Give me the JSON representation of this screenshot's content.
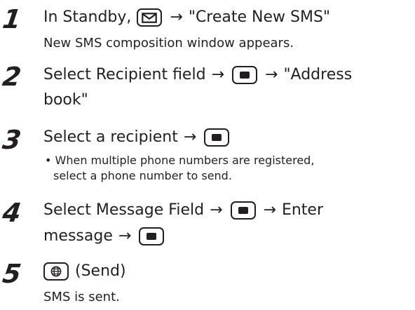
{
  "steps": [
    {
      "number": "1",
      "line1_before": "In Standby,",
      "arrow": "→",
      "line1_after": "\"Create New SMS\"",
      "note": "New SMS composition window appears.",
      "icon": "mail-key-icon"
    },
    {
      "number": "2",
      "line1_before": "Select Recipient field",
      "arrow": "→",
      "line1_mid": "→",
      "line1_after": "\"Address",
      "line2": "book\"",
      "icon": "center-key-icon"
    },
    {
      "number": "3",
      "line1_before": "Select a recipient",
      "arrow": "→",
      "bullet_line1": "• When multiple phone numbers are registered,",
      "bullet_line2": "select a phone number to send.",
      "icon": "center-key-icon"
    },
    {
      "number": "4",
      "line1_before": "Select Message Field",
      "arrow": "→",
      "line1_mid": "→",
      "line1_after": "Enter",
      "line2_before": "message",
      "line2_arrow": "→",
      "icon": "center-key-icon"
    },
    {
      "number": "5",
      "line1_after": "(Send)",
      "note": "SMS is sent.",
      "icon": "globe-key-icon"
    }
  ]
}
